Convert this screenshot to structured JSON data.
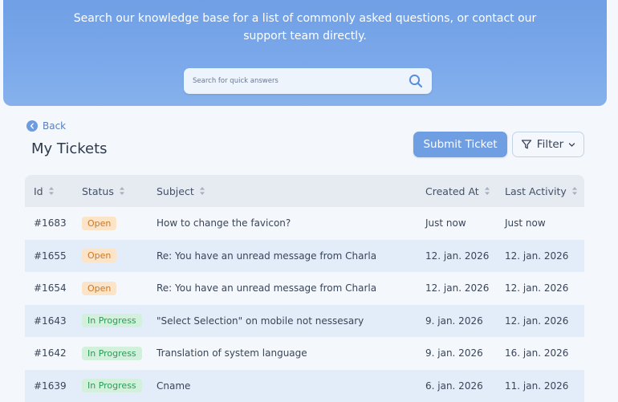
{
  "hero": {
    "line1": "Search our knowledge base for a list of commonly asked questions, or contact our",
    "line2": "support team directly.",
    "search_placeholder": "Search for quick answers"
  },
  "nav": {
    "back_label": "Back"
  },
  "page": {
    "title": "My Tickets"
  },
  "toolbar": {
    "submit_label": "Submit Ticket",
    "filter_label": "Filter"
  },
  "table": {
    "columns": [
      "Id",
      "Status",
      "Subject",
      "Created At",
      "Last Activity"
    ],
    "rows": [
      {
        "id": "#1683",
        "status": "Open",
        "status_type": "open",
        "subject": "How to change the favicon?",
        "created": "Just now",
        "last": "Just now"
      },
      {
        "id": "#1655",
        "status": "Open",
        "status_type": "open",
        "subject": "Re: You have an unread message from Charla",
        "created": "12. jan. 2026",
        "last": "12. jan. 2026"
      },
      {
        "id": "#1654",
        "status": "Open",
        "status_type": "open",
        "subject": "Re: You have an unread message from Charla",
        "created": "12. jan. 2026",
        "last": "12. jan. 2026"
      },
      {
        "id": "#1643",
        "status": "In Progress",
        "status_type": "progress",
        "subject": "\"Select Selection\" on mobile not nessesary",
        "created": "9. jan. 2026",
        "last": "12. jan. 2026"
      },
      {
        "id": "#1642",
        "status": "In Progress",
        "status_type": "progress",
        "subject": "Translation of system language",
        "created": "9. jan. 2026",
        "last": "16. jan. 2026"
      },
      {
        "id": "#1639",
        "status": "In Progress",
        "status_type": "progress",
        "subject": "Cname",
        "created": "6. jan. 2026",
        "last": "11. jan. 2026"
      }
    ]
  },
  "colors": {
    "accent": "#6f9ee3",
    "open_badge_bg": "#fbe4c8",
    "open_badge_text": "#c8792a",
    "progress_badge_bg": "#d3f0dc",
    "progress_badge_text": "#2e9a58"
  },
  "icons": {
    "search": "search-icon",
    "back": "chevron-left-icon",
    "filter": "filter-icon",
    "dropdown": "chevron-down-icon",
    "sort": "sort-icon"
  }
}
